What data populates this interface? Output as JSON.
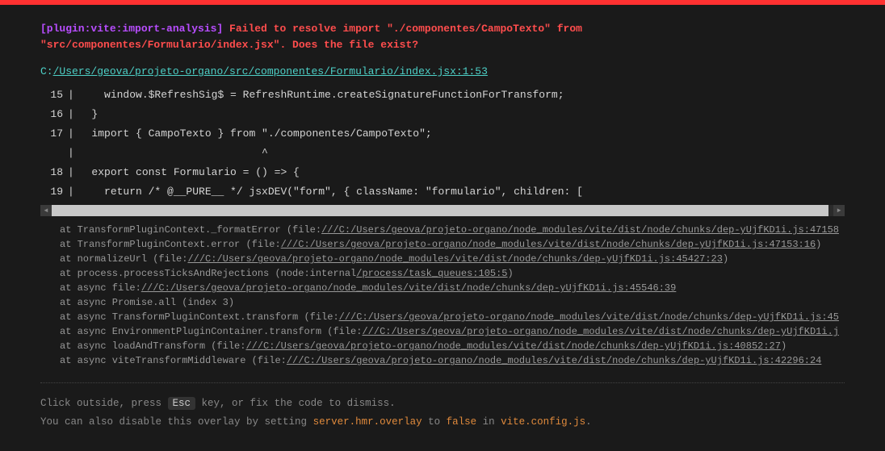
{
  "header": {
    "plugin_tag": "[plugin:vite:import-analysis]",
    "error_line1": " Failed to resolve import \"./componentes/CampoTexto\" from ",
    "error_line2": "\"src/componentes/Formulario/index.jsx\". Does the file exist?"
  },
  "file": {
    "prefix": "C:",
    "path": "/Users/geova/projeto-organo/src/componentes/Formulario/index.jsx:1:53"
  },
  "code": [
    {
      "no": "15",
      "text": "    window.$RefreshSig$ = RefreshRuntime.createSignatureFunctionForTransform;"
    },
    {
      "no": "16",
      "text": "  }"
    },
    {
      "no": "17",
      "text": "  import { CampoTexto } from \"./componentes/CampoTexto\";"
    },
    {
      "no": "",
      "text": "                             ^"
    },
    {
      "no": "18",
      "text": "  export const Formulario = () => {"
    },
    {
      "no": "19",
      "text": "    return /* @__PURE__ */ jsxDEV(\"form\", { className: \"formulario\", children: ["
    }
  ],
  "stack": [
    {
      "pre": "at TransformPluginContext._formatError (file:",
      "link": "///C:/Users/geova/projeto-organo/node_modules/vite/dist/node/chunks/dep-yUjfKD1i.js:47158",
      "post": ""
    },
    {
      "pre": "at TransformPluginContext.error (file:",
      "link": "///C:/Users/geova/projeto-organo/node_modules/vite/dist/node/chunks/dep-yUjfKD1i.js:47153:16",
      "post": ")"
    },
    {
      "pre": "at normalizeUrl (file:",
      "link": "///C:/Users/geova/projeto-organo/node_modules/vite/dist/node/chunks/dep-yUjfKD1i.js:45427:23",
      "post": ")"
    },
    {
      "pre": "at process.processTicksAndRejections (node:internal",
      "link": "/process/task_queues:105:5",
      "post": ")"
    },
    {
      "pre": "at async file:",
      "link": "///C:/Users/geova/projeto-organo/node_modules/vite/dist/node/chunks/dep-yUjfKD1i.js:45546:39",
      "post": ""
    },
    {
      "pre": "at async Promise.all (index 3)",
      "link": "",
      "post": ""
    },
    {
      "pre": "at async TransformPluginContext.transform (file:",
      "link": "///C:/Users/geova/projeto-organo/node_modules/vite/dist/node/chunks/dep-yUjfKD1i.js:45",
      "post": ""
    },
    {
      "pre": "at async EnvironmentPluginContainer.transform (file:",
      "link": "///C:/Users/geova/projeto-organo/node_modules/vite/dist/node/chunks/dep-yUjfKD1i.j",
      "post": ""
    },
    {
      "pre": "at async loadAndTransform (file:",
      "link": "///C:/Users/geova/projeto-organo/node_modules/vite/dist/node/chunks/dep-yUjfKD1i.js:40852:27",
      "post": ")"
    },
    {
      "pre": "at async viteTransformMiddleware (file:",
      "link": "///C:/Users/geova/projeto-organo/node_modules/vite/dist/node/chunks/dep-yUjfKD1i.js:42296:24",
      "post": ""
    }
  ],
  "footer": {
    "line1_a": "Click outside, press ",
    "esc": "Esc",
    "line1_b": " key, or fix the code to dismiss.",
    "line2_a": "You can also disable this overlay by setting ",
    "cfg_key": "server.hmr.overlay",
    "line2_b": " to ",
    "cfg_val": "false",
    "line2_c": " in ",
    "cfg_file": "vite.config.js",
    "line2_d": "."
  }
}
